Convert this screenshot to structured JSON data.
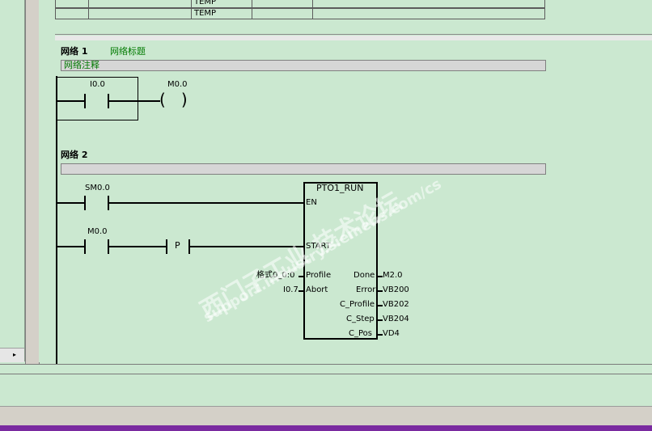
{
  "variable_table": {
    "rows": [
      {
        "type": "TEMP"
      },
      {
        "type": "TEMP"
      }
    ]
  },
  "networks": [
    {
      "number_label": "网络 1",
      "title": "网络标题",
      "comment": "网络注释",
      "contact": "I0.0",
      "coil": "M0.0"
    },
    {
      "number_label": "网络 2",
      "contact_sm": "SM0.0",
      "contact_m": "M0.0",
      "edge": "P",
      "box": {
        "name": "PTO1_RUN",
        "inputs": [
          "EN",
          "START",
          "Profile",
          "Abort"
        ],
        "outputs": [
          "Done",
          "Error",
          "C_Profile",
          "C_Step",
          "C_Pos"
        ],
        "input_values": {
          "profile": "格式0_0:0",
          "abort": "I0.7"
        },
        "output_values": [
          "M2.0",
          "VB200",
          "VB202",
          "VB204",
          "VD4"
        ]
      }
    }
  ],
  "watermark": {
    "line1": "西门子工业 技术论坛",
    "line2": "support.industry.siemens.com/cs"
  },
  "icons": {
    "scroll_right": "scroll-right-arrow-icon"
  }
}
